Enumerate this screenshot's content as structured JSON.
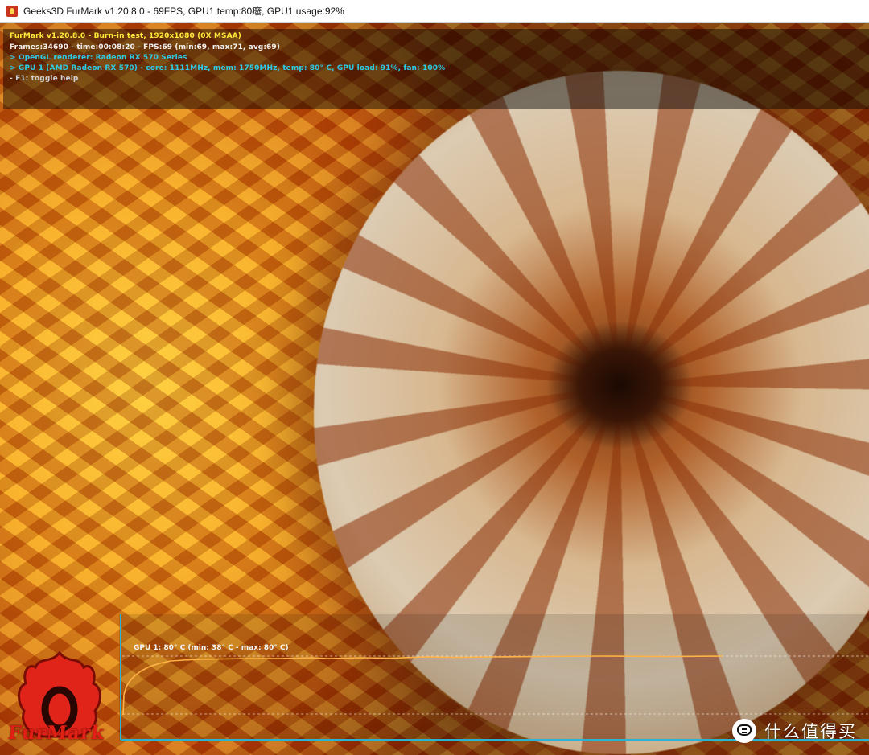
{
  "window": {
    "title": "Geeks3D FurMark v1.20.8.0 - 69FPS, GPU1 temp:80癈, GPU1 usage:92%"
  },
  "hud": {
    "line1": "FurMark v1.20.8.0 - Burn-in test, 1920x1080 (0X MSAA)",
    "line2": "Frames:34690 - time:00:08:20 - FPS:69 (min:69, max:71, avg:69)",
    "line3": "> OpenGL renderer: Radeon RX 570 Series",
    "line4": "> GPU 1 (AMD Radeon RX 570) - core: 1111MHz, mem: 1750MHz, temp: 80° C, GPU load: 91%, fan: 100%",
    "line5": "- F1: toggle help"
  },
  "temp_graph": {
    "label": "GPU 1: 80° C (min: 38° C - max: 80° C)",
    "min_c": 38,
    "max_c": 80,
    "current_c": 80,
    "line_color": "#ffb347",
    "axis_color": "#2bb3d6"
  },
  "logo": {
    "text": "FurMark",
    "color": "#e02015"
  },
  "watermark": {
    "icon": "smzdm-face-icon",
    "text": "什么值得买"
  }
}
